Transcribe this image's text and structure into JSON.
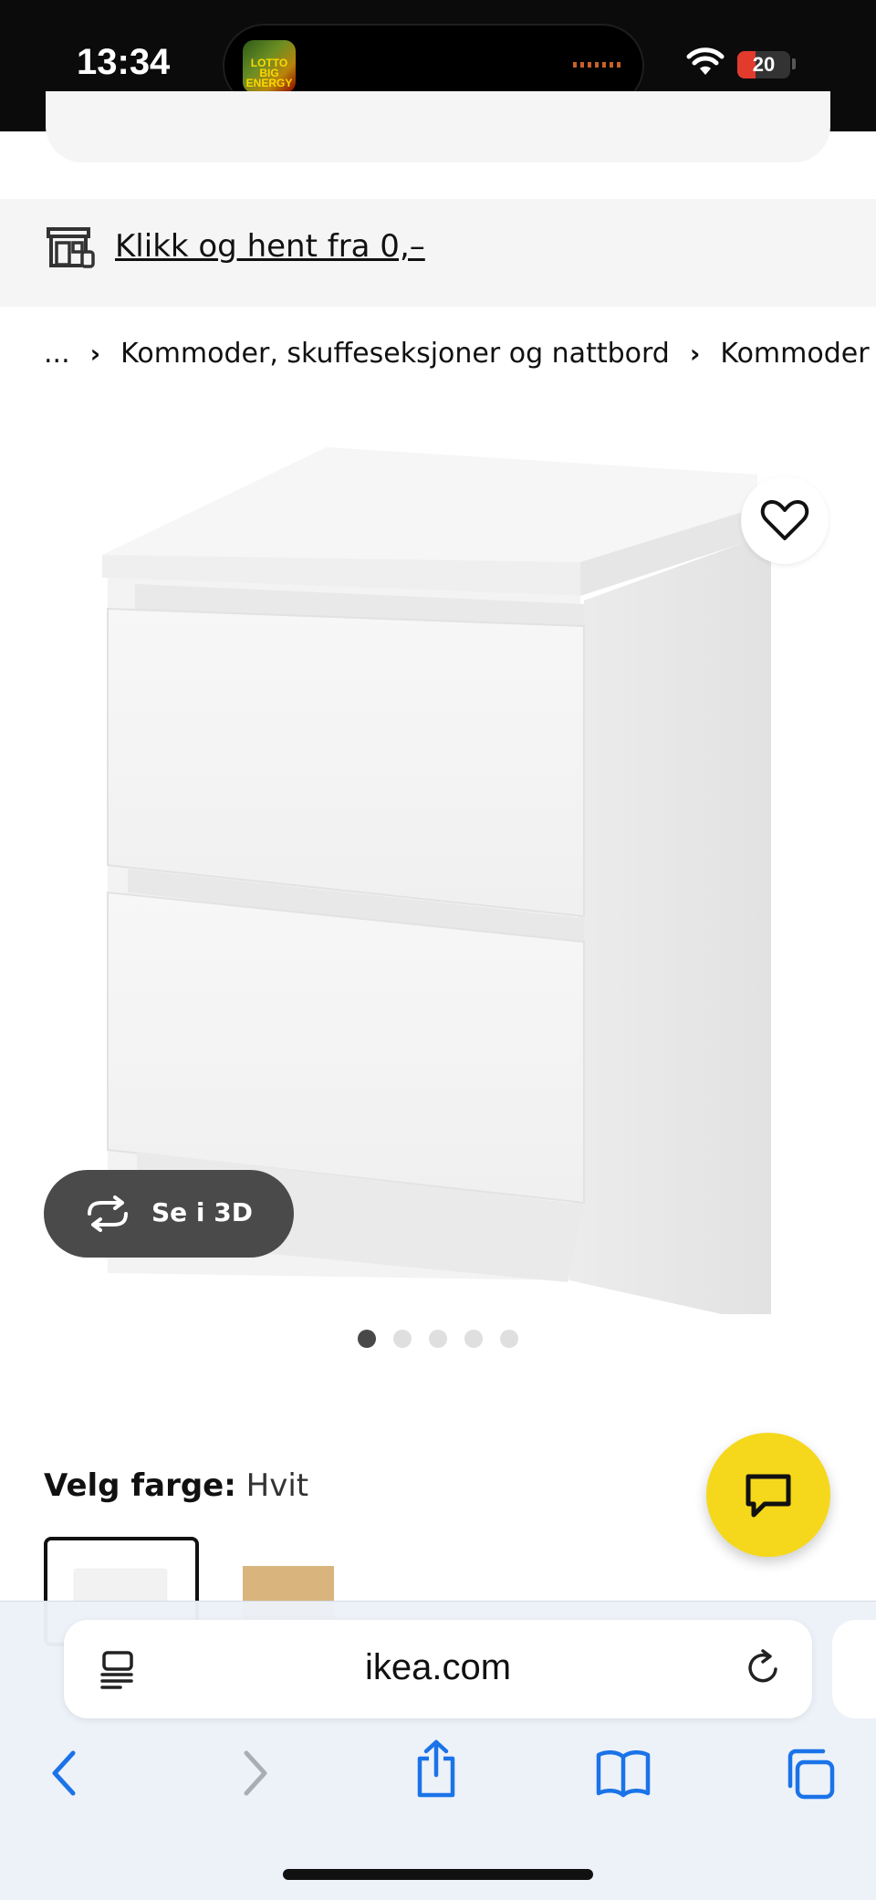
{
  "status_bar": {
    "time": "13:34",
    "battery": "20",
    "island_app_label": "LOTTO BIG ENERGY"
  },
  "click_collect": {
    "text": "Klikk og hent fra 0,–"
  },
  "breadcrumb": {
    "ellipsis": "...",
    "items": [
      "Kommoder, skuffeseksjoner og nattbord",
      "Kommoder"
    ]
  },
  "product": {
    "favorite_icon": "heart-icon",
    "view_3d_label": "Se i 3D",
    "image_count": 5,
    "active_image": 1
  },
  "color": {
    "label": "Velg farge:",
    "value": "Hvit",
    "options": [
      {
        "name": "white",
        "color": "#f2f2f2"
      },
      {
        "name": "oak",
        "color": "#d9b57d"
      }
    ]
  },
  "chat": {
    "icon": "chat-icon",
    "color": "#f5d81b"
  },
  "browser": {
    "url": "ikea.com",
    "reader_icon": "reader-icon",
    "reload_icon": "reload-icon",
    "toolbar": [
      "back-icon",
      "forward-icon",
      "share-icon",
      "bookmarks-icon",
      "tabs-icon"
    ]
  }
}
